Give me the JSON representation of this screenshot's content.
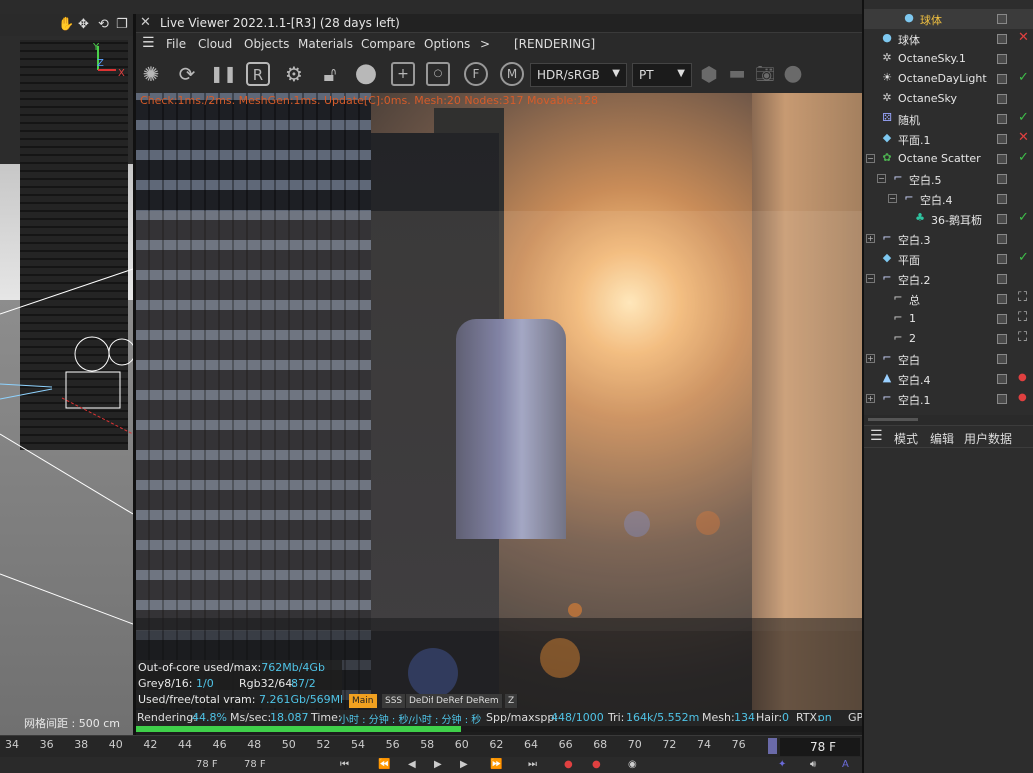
{
  "viewport": {
    "axis_y": "Y",
    "axis_z": "Z",
    "axis_x": "X",
    "grid_spacing": "网格间距 : 500 cm"
  },
  "live_viewer": {
    "title": "Live Viewer 2022.1.1-[R3] (28 days left)",
    "menu": [
      "File",
      "Cloud",
      "Objects",
      "Materials",
      "Compare",
      "Options"
    ],
    "menu_more": ">",
    "state": "[RENDERING]",
    "tonemap_select": "HDR/sRGB",
    "kernel_select": "PT",
    "status_message": "Check:1ms./2ms. MeshGen:1ms. Update[C]:0ms. Mesh:20 Nodes:317 Movable:128",
    "info": {
      "out_of_core_label": "Out-of-core used/max:",
      "out_of_core_value": "762Mb/4Gb",
      "grey_label": "Grey8/16:",
      "grey_value": "1/0",
      "rgb_label": "Rgb32/64:",
      "rgb_value": "87/2",
      "vram_label": "Used/free/total vram:",
      "vram_value": "7.261Gb/569Mb/11.9"
    },
    "pass_tabs": [
      "Main",
      "SSS",
      "DeDif",
      "DeRef",
      "DeRem",
      "Z"
    ],
    "stats": {
      "rendering_label": "Rendering:",
      "rendering_value": "44.8%",
      "mssec_label": "Ms/sec:",
      "mssec_value": "18.087",
      "time_label": "Time:",
      "time_value": "小时 : 分钟 : 秒/小时 : 分钟 : 秒",
      "spp_label": "Spp/maxspp:",
      "spp_value": "448/1000",
      "tri_label": "Tri:",
      "tri_value": "164k/5.552m",
      "mesh_label": "Mesh:",
      "mesh_value": "134",
      "hair_label": "Hair:",
      "hair_value": "0",
      "rtx_label": "RTX:",
      "rtx_value": "on",
      "gp_label": "GP"
    },
    "progress": 0.448
  },
  "timeline": {
    "ticks": [
      "34",
      "36",
      "38",
      "40",
      "42",
      "44",
      "46",
      "48",
      "50",
      "52",
      "54",
      "56",
      "58",
      "60",
      "62",
      "64",
      "66",
      "68",
      "70",
      "72",
      "74",
      "76"
    ],
    "current_frame": "78 F",
    "start_field": "78 F",
    "end_field": "78 F"
  },
  "objects": [
    {
      "name": "球体",
      "indent": 2,
      "icon": "sphere",
      "color": "#f0c040",
      "highlight": true,
      "status": "none"
    },
    {
      "name": "球体",
      "indent": 0,
      "icon": "sphere",
      "highlight": false,
      "status": "cross"
    },
    {
      "name": "OctaneSky.1",
      "indent": 0,
      "icon": "sky",
      "highlight": false,
      "status": "none"
    },
    {
      "name": "OctaneDayLight",
      "indent": 0,
      "icon": "sun",
      "highlight": false,
      "status": "check"
    },
    {
      "name": "OctaneSky",
      "indent": 0,
      "icon": "sky",
      "highlight": false,
      "status": "none"
    },
    {
      "name": "随机",
      "indent": 0,
      "icon": "dice",
      "highlight": false,
      "status": "check"
    },
    {
      "name": "平面.1",
      "indent": 0,
      "icon": "plane",
      "highlight": false,
      "status": "cross"
    },
    {
      "name": "Octane Scatter",
      "indent": 0,
      "icon": "scatter",
      "highlight": false,
      "status": "check",
      "expander": "-"
    },
    {
      "name": "空白.5",
      "indent": 1,
      "icon": "null",
      "highlight": false,
      "status": "none",
      "expander": "-"
    },
    {
      "name": "空白.4",
      "indent": 2,
      "icon": "null",
      "highlight": false,
      "status": "none",
      "expander": "-"
    },
    {
      "name": "36-鹅耳枥",
      "indent": 3,
      "icon": "tree",
      "highlight": false,
      "status": "check"
    },
    {
      "name": "空白.3",
      "indent": 0,
      "icon": "null",
      "highlight": false,
      "status": "none",
      "expander": "+"
    },
    {
      "name": "平面",
      "indent": 0,
      "icon": "plane",
      "highlight": false,
      "status": "check"
    },
    {
      "name": "空白.2",
      "indent": 0,
      "icon": "null",
      "highlight": false,
      "status": "none",
      "expander": "-"
    },
    {
      "name": "总",
      "indent": 1,
      "icon": "camera",
      "highlight": false,
      "status": "target"
    },
    {
      "name": "1",
      "indent": 1,
      "icon": "camera",
      "highlight": false,
      "status": "target"
    },
    {
      "name": "2",
      "indent": 1,
      "icon": "camera",
      "highlight": false,
      "status": "target"
    },
    {
      "name": "空白",
      "indent": 0,
      "icon": "null",
      "highlight": false,
      "status": "none",
      "expander": "+"
    },
    {
      "name": "空白.4",
      "indent": 0,
      "icon": "lightobj",
      "highlight": false,
      "status": "dot"
    },
    {
      "name": "空白.1",
      "indent": 0,
      "icon": "null",
      "highlight": false,
      "status": "dot",
      "expander": "+"
    }
  ],
  "attributes": {
    "tabs": [
      "模式",
      "编辑",
      "用户数据"
    ]
  },
  "colors": {
    "accent": "#4fc3e6",
    "progress": "#3fd04a",
    "warning": "#d65c2a",
    "check": "#3fbf4a",
    "cross": "#e04040",
    "dot": "#e04040"
  }
}
